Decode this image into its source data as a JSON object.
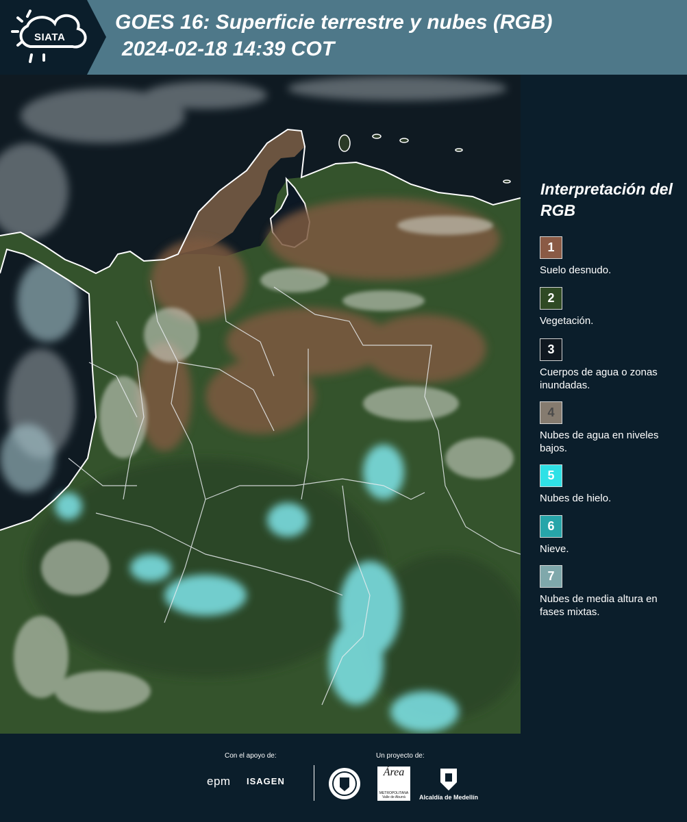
{
  "header": {
    "logo_text": "SIATA",
    "title": "GOES 16: Superficie terrestre y nubes (RGB)",
    "timestamp": "2024-02-18 14:39 COT"
  },
  "legend": {
    "title": "Interpretación del RGB",
    "items": [
      {
        "number": "1",
        "label": "Suelo desnudo.",
        "color": "#8a5a45",
        "text_color": "#ffffff"
      },
      {
        "number": "2",
        "label": "Vegetación.",
        "color": "#2f4a24",
        "text_color": "#ffffff"
      },
      {
        "number": "3",
        "label": "Cuerpos de agua o zonas inundadas.",
        "color": "#101820",
        "text_color": "#ffffff"
      },
      {
        "number": "4",
        "label": "Nubes de agua en niveles bajos.",
        "color": "#857b6f",
        "text_color": "#4a4a4a"
      },
      {
        "number": "5",
        "label": "Nubes de hielo.",
        "color": "#2fe1e6",
        "text_color": "#ffffff"
      },
      {
        "number": "6",
        "label": "Nieve.",
        "color": "#27a5a9",
        "text_color": "#ffffff"
      },
      {
        "number": "7",
        "label": "Nubes de media altura en fases mixtas.",
        "color": "#7fa8ab",
        "text_color": "#ffffff"
      }
    ]
  },
  "footer": {
    "support_label": "Con el apoyo de:",
    "project_label": "Un proyecto de:",
    "sponsor_1": "epm",
    "sponsor_2": "ISAGEN",
    "partner_area": "Área",
    "partner_area_sub": "METROPOLITANA Valle de Aburrá",
    "partner_alcaldia": "Alcaldía de Medellín"
  },
  "colors": {
    "header_bg": "#4e7889",
    "panel_bg": "#0b1e2b",
    "vegetation": "#34532c",
    "bare_soil": "#7a5a40",
    "ocean": "#0e1820",
    "ice_cloud": "#7fe5ea"
  }
}
